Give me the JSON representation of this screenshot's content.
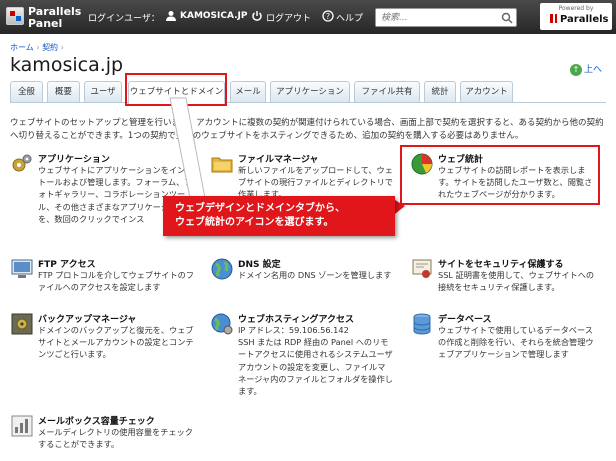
{
  "header": {
    "logo_line1": "Parallels",
    "logo_line2": "Panel",
    "login_label": "ログインユーザ：",
    "username": "KAMOSICA.JP",
    "logout": "ログアウト",
    "help": "ヘルプ",
    "search_placeholder": "検索...",
    "powered_by": "Powered by",
    "powered_brand": "Parallels"
  },
  "breadcrumb": {
    "home": "ホーム",
    "sep": "›",
    "contract": "契約",
    "sep2": "›"
  },
  "page_title": "kamosica.jp",
  "up_link": "上へ",
  "tabs": [
    {
      "label": "全般"
    },
    {
      "label": "概要"
    },
    {
      "label": "ユーザ"
    },
    {
      "label": "ウェブサイトとドメイン"
    },
    {
      "label": "メール"
    },
    {
      "label": "アプリケーション"
    },
    {
      "label": "ファイル共有"
    },
    {
      "label": "統計"
    },
    {
      "label": "アカウント"
    }
  ],
  "description": "ウェブサイトのセットアップと管理を行います。アカウントに複数の契約が関連付けられている場合、画面上部で契約を選択すると、ある契約から他の契約へ切り替えることができます。1つの契約で多数のウェブサイトをホスティングできるため、追加の契約を購入する必要はありません。",
  "items": {
    "apps": {
      "title": "アプリケーション",
      "text": "ウェブサイトにアプリケーションをインストールおよび管理します。フォーラム、フォトギャラリー、コラボレーションツール、その他さまざまなアプリケーションを、数回のクリックでインス"
    },
    "filemgr": {
      "title": "ファイルマネージャ",
      "text": "新しいファイルをアップロードして、ウェブサイトの現行ファイルとディレクトリで作業します。"
    },
    "webstats": {
      "title": "ウェブ統計",
      "text": "ウェブサイトの訪問レポートを表示します。サイトを訪問したユーザ数と、閲覧されたウェブページが分かります。"
    },
    "ftp": {
      "title": "FTP アクセス",
      "text": "FTP プロトコルを介してウェブサイトのファイルへのアクセスを設定します"
    },
    "dns": {
      "title": "DNS 設定",
      "text": "ドメイン名用の DNS ゾーンを管理します"
    },
    "ssl": {
      "title": "サイトをセキュリティ保護する",
      "text": "SSL 証明書を使用して、ウェブサイトへの接続をセキュリティ保護します。"
    },
    "backup": {
      "title": "バックアップマネージャ",
      "text": "ドメインのバックアップと復元を、ウェブサイトとメールアカウントの設定とコンテンツごと行います。"
    },
    "hosting": {
      "title": "ウェブホスティングアクセス",
      "text": "IP アドレス：59.106.56.142\nSSH または RDP 経由の Panel へのリモートアクセスに使用されるシステムユーザアカウントの設定を変更し、ファイルマネージャ内のファイルとフォルダを操作します。"
    },
    "database": {
      "title": "データベース",
      "text": "ウェブサイトで使用しているデータベースの作成と削除を行い、それらを統合管理ウェブアプリケーションで管理します"
    },
    "mailbox": {
      "title": "メールボックス容量チェック",
      "text": "メールディレクトリの使用容量をチェックすることができます。"
    }
  },
  "callout": {
    "line1": "ウェブデザインとドメインタブから、",
    "line2": "ウェブ統計のアイコンを選びます。"
  },
  "colors": {
    "highlight": "#e0161b",
    "link": "#1155cc",
    "topbar": "#333333"
  }
}
